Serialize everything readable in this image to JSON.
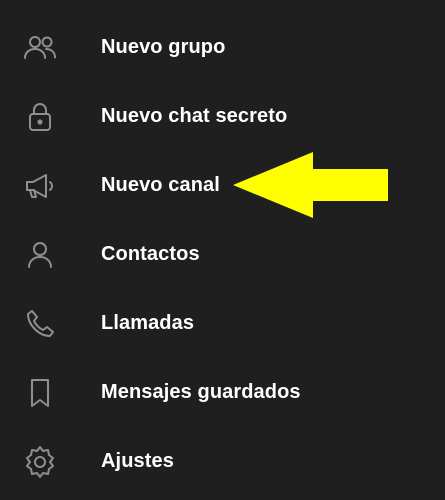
{
  "menu": {
    "items": [
      {
        "label": "Nuevo grupo",
        "icon": "group-icon"
      },
      {
        "label": "Nuevo chat secreto",
        "icon": "lock-icon"
      },
      {
        "label": "Nuevo canal",
        "icon": "megaphone-icon"
      },
      {
        "label": "Contactos",
        "icon": "person-icon"
      },
      {
        "label": "Llamadas",
        "icon": "phone-icon"
      },
      {
        "label": "Mensajes guardados",
        "icon": "bookmark-icon"
      },
      {
        "label": "Ajustes",
        "icon": "gear-icon"
      }
    ]
  },
  "annotation": {
    "arrow_color": "#ffff00",
    "arrow_icon": "arrow-left-icon"
  },
  "colors": {
    "background": "#1f1f1f",
    "text": "#ffffff",
    "icon": "#8e8e93"
  }
}
